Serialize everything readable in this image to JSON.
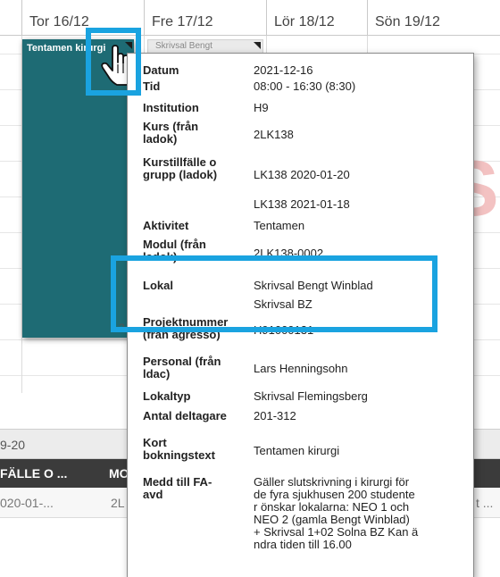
{
  "calendar": {
    "days": [
      "Tor 16/12",
      "Fre 17/12",
      "Lör 18/12",
      "Sön 19/12"
    ]
  },
  "events": [
    {
      "title": "Tentamen kirurgi",
      "color": "#1e6b74"
    },
    {
      "title": "Skrivsal Bengt"
    }
  ],
  "tooltip": {
    "fields": [
      {
        "label": "Datum",
        "value": "2021-12-16"
      },
      {
        "label": "Tid",
        "value": "08:00 - 16:30 (8:30)"
      },
      {
        "label": "Institution",
        "value": "H9"
      },
      {
        "label": "Kurs (från\nladok)",
        "value": "2LK138"
      },
      {
        "label": "Kurstillfälle o\ngrupp (ladok)",
        "value": "LK138 2020-01-20"
      },
      {
        "label": "",
        "value": "LK138 2021-01-18"
      },
      {
        "label": "Aktivitet",
        "value": "Tentamen"
      },
      {
        "label": "Modul (från\nladok)",
        "value": "2LK138-0002"
      },
      {
        "label": "Lokal",
        "value": "Skrivsal Bengt Winblad"
      },
      {
        "label": "",
        "value": "Skrivsal BZ"
      },
      {
        "label": "Projektnummer\n(från agresso)",
        "value": "H91000131"
      },
      {
        "label": "Personal (från\nldac)",
        "value": "Lars Henningsohn"
      },
      {
        "label": "Lokaltyp",
        "value": "Skrivsal Flemingsberg"
      },
      {
        "label": "Antal deltagare",
        "value": "201-312"
      },
      {
        "label": "Kort\nbokningstext",
        "value": "Tentamen kirurgi"
      },
      {
        "label": "Medd till FA-\navd",
        "value": "Gäller slutskrivning i kirurgi för\nde fyra sjukhusen 200 studente\nr önskar lokalarna: NEO 1 och\nNEO 2 (gamla Bengt Winblad)\n+ Skrivsal 1+02 Solna BZ Kan ä\nndra tiden till 16.00"
      }
    ]
  },
  "lower_table": {
    "filter_text": "9-20",
    "headers": [
      "FÄLLE O ...",
      "MO"
    ],
    "row": [
      "020-01-...",
      "2L",
      "t ..."
    ]
  },
  "misc": {
    "edge_number": "2",
    "background_letter": "S"
  },
  "colors": {
    "highlight": "#1aa3e0",
    "event_teal": "#1e6b74",
    "table_header": "#3b3b3b"
  }
}
